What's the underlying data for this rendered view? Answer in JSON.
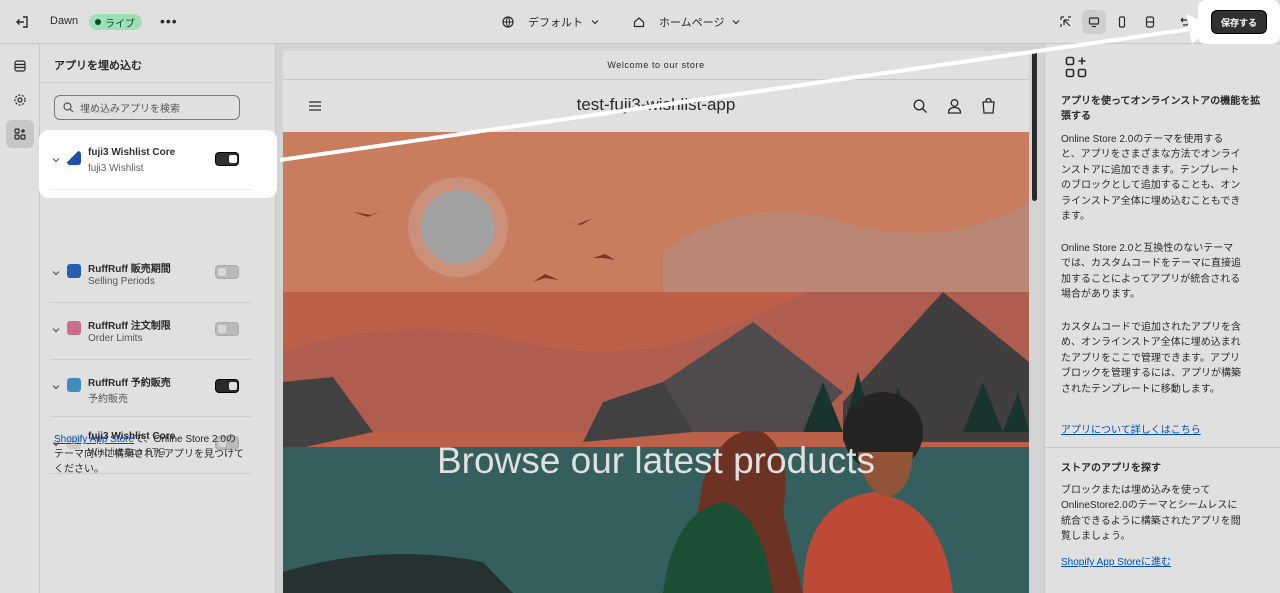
{
  "topbar": {
    "theme_name": "Dawn",
    "live_badge": "ライブ",
    "more": "•••",
    "market": "デフォルト",
    "page": "ホームページ",
    "save_label": "保存する"
  },
  "left_panel": {
    "title": "アプリを埋め込む",
    "search_placeholder": "埋め込みアプリを検索",
    "apps": [
      {
        "name": "fuji3 Wishlist Core",
        "sub": "fuji3 Wishlist",
        "enabled": true
      },
      {
        "name": "RuffRuff 販売期間",
        "sub": "Selling Periods",
        "enabled": false
      },
      {
        "name": "RuffRuff 注文制限",
        "sub": "Order Limits",
        "enabled": false
      },
      {
        "name": "RuffRuff 予約販売",
        "sub": "予約販売",
        "enabled": true
      },
      {
        "name": "fuji3 Wishlist Core",
        "sub": "Wishlist App STG",
        "enabled": false
      }
    ],
    "footer_link": "Shopify App Store",
    "footer_text": "で、Online Store 2.0のテーマ向けに構築されたアプリを見つけてください。"
  },
  "preview": {
    "announcement": "Welcome to our store",
    "store_name": "test-fuji3-wishlist-app",
    "hero_title": "Browse our latest products"
  },
  "right_panel": {
    "heading1": "アプリを使ってオンラインストアの機能を拡張する",
    "para1": "Online Store 2.0のテーマを使用すると、アプリをさまざまな方法でオンラインストアに追加できます。テンプレートのブロックとして追加することも、オンラインストア全体に埋め込むこともできます。",
    "para2": "Online Store 2.0と互換性のないテーマでは、カスタムコードをテーマに直接追加することによってアプリが統合される場合があります。",
    "para3": "カスタムコードで追加されたアプリを含め、オンラインストア全体に埋め込まれたアプリをここで管理できます。アプリブロックを管理するには、アプリが構築されたテンプレートに移動します。",
    "link1": "アプリについて詳しくはこちら",
    "heading2": "ストアのアプリを探す",
    "para4": "ブロックまたは埋め込みを使ってOnlineStore2.0のテーマとシームレスに統合できるように構築されたアプリを閲覧しましょう。",
    "link2": "Shopify App Storeに進む"
  },
  "colors": {
    "accent_link": "#005bd3",
    "live_badge_bg": "#b4fed2",
    "primary_button": "#303030"
  },
  "icons": [
    "exit-icon",
    "globe-icon",
    "home-icon",
    "chevron-down-icon",
    "inspector-icon",
    "desktop-icon",
    "mobile-icon",
    "fullscreen-icon",
    "undo-icon",
    "sections-icon",
    "settings-icon",
    "apps-icon",
    "search-icon",
    "menu-icon",
    "account-icon",
    "cart-icon",
    "app-add-icon"
  ]
}
